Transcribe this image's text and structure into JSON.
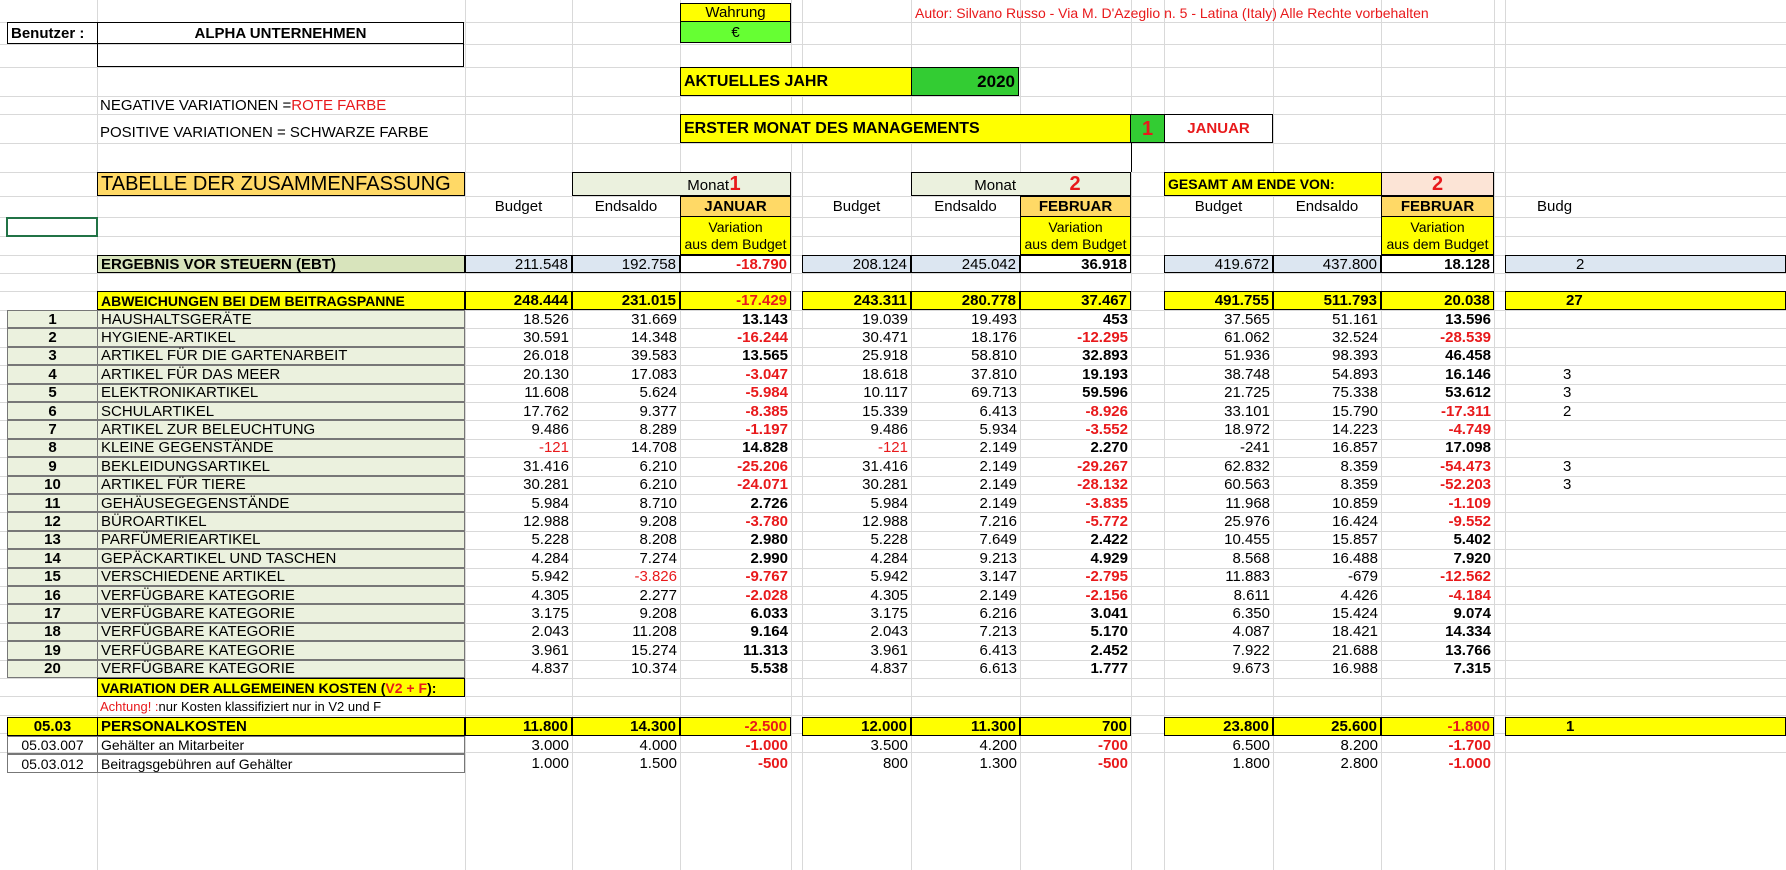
{
  "header": {
    "user_label": "Benutzer :",
    "company": "ALPHA UNTERNEHMEN",
    "currency_label": "Wahrung",
    "currency_value": "€",
    "author": "Autor: Silvano Russo - Via M. D'Azeglio n. 5 - Latina (Italy)   Alle Rechte vorbehalten",
    "current_year_label": "AKTUELLES JAHR",
    "current_year": "2020",
    "first_month_label": "ERSTER MONAT DES MANAGEMENTS",
    "first_month_num": "1",
    "first_month_name": "JANUAR",
    "neg_note_prefix": "NEGATIVE VARIATIONEN = ",
    "neg_note_color": "ROTE FARBE",
    "pos_note": "POSITIVE VARIATIONEN = SCHWARZE FARBE",
    "summary_title": "TABELLE DER ZUSAMMENFASSUNG"
  },
  "blocks": [
    {
      "top_label": "Monat",
      "top_num": "1",
      "month": "JANUAR"
    },
    {
      "top_label": "Monat",
      "top_num": "2",
      "month": "FEBRUAR"
    },
    {
      "top_label": "GESAMT AM ENDE VON:",
      "top_num": "2",
      "month": "FEBRUAR"
    }
  ],
  "col_headers": {
    "budget": "Budget",
    "endsaldo": "Endsaldo",
    "variation_1": "Variation",
    "variation_2": "aus dem Budget",
    "next_budget_partial": "Budg"
  },
  "ebt": {
    "label": "ERGEBNIS VOR STEUERN (EBT)",
    "values": [
      [
        "211.548",
        "192.758",
        "-18.790"
      ],
      [
        "208.124",
        "245.042",
        "36.918"
      ],
      [
        "419.672",
        "437.800",
        "18.128"
      ]
    ],
    "next_partial": "2"
  },
  "margin": {
    "label": "ABWEICHUNGEN BEI DEM BEITRAGSPANNE",
    "values": [
      [
        "248.444",
        "231.015",
        "-17.429"
      ],
      [
        "243.311",
        "280.778",
        "37.467"
      ],
      [
        "491.755",
        "511.793",
        "20.038"
      ]
    ],
    "next_partial": "27"
  },
  "rows": [
    {
      "num": "1",
      "label": "HAUSHALTSGERÄTE",
      "v": [
        [
          "18.526",
          "31.669",
          "13.143"
        ],
        [
          "19.039",
          "19.493",
          "453"
        ],
        [
          "37.565",
          "51.161",
          "13.596"
        ]
      ],
      "next": ""
    },
    {
      "num": "2",
      "label": "HYGIENE-ARTIKEL",
      "v": [
        [
          "30.591",
          "14.348",
          "-16.244"
        ],
        [
          "30.471",
          "18.176",
          "-12.295"
        ],
        [
          "61.062",
          "32.524",
          "-28.539"
        ]
      ],
      "next": ""
    },
    {
      "num": "3",
      "label": "ARTIKEL FÜR DIE GARTENARBEIT",
      "v": [
        [
          "26.018",
          "39.583",
          "13.565"
        ],
        [
          "25.918",
          "58.810",
          "32.893"
        ],
        [
          "51.936",
          "98.393",
          "46.458"
        ]
      ],
      "next": ""
    },
    {
      "num": "4",
      "label": "ARTIKEL FÜR DAS MEER",
      "v": [
        [
          "20.130",
          "17.083",
          "-3.047"
        ],
        [
          "18.618",
          "37.810",
          "19.193"
        ],
        [
          "38.748",
          "54.893",
          "16.146"
        ]
      ],
      "next": "3"
    },
    {
      "num": "5",
      "label": "ELEKTRONIKARTIKEL",
      "v": [
        [
          "11.608",
          "5.624",
          "-5.984"
        ],
        [
          "10.117",
          "69.713",
          "59.596"
        ],
        [
          "21.725",
          "75.338",
          "53.612"
        ]
      ],
      "next": "3"
    },
    {
      "num": "6",
      "label": "SCHULARTIKEL",
      "v": [
        [
          "17.762",
          "9.377",
          "-8.385"
        ],
        [
          "15.339",
          "6.413",
          "-8.926"
        ],
        [
          "33.101",
          "15.790",
          "-17.311"
        ]
      ],
      "next": "2"
    },
    {
      "num": "7",
      "label": "ARTIKEL ZUR BELEUCHTUNG",
      "v": [
        [
          "9.486",
          "8.289",
          "-1.197"
        ],
        [
          "9.486",
          "5.934",
          "-3.552"
        ],
        [
          "18.972",
          "14.223",
          "-4.749"
        ]
      ],
      "next": ""
    },
    {
      "num": "8",
      "label": "KLEINE GEGENSTÄNDE",
      "v": [
        [
          "-121",
          "14.708",
          "14.828"
        ],
        [
          "-121",
          "2.149",
          "2.270"
        ],
        [
          "-241",
          "16.857",
          "17.098"
        ]
      ],
      "next": ""
    },
    {
      "num": "9",
      "label": "BEKLEIDUNGSARTIKEL",
      "v": [
        [
          "31.416",
          "6.210",
          "-25.206"
        ],
        [
          "31.416",
          "2.149",
          "-29.267"
        ],
        [
          "62.832",
          "8.359",
          "-54.473"
        ]
      ],
      "next": "3"
    },
    {
      "num": "10",
      "label": "ARTIKEL FÜR TIERE",
      "v": [
        [
          "30.281",
          "6.210",
          "-24.071"
        ],
        [
          "30.281",
          "2.149",
          "-28.132"
        ],
        [
          "60.563",
          "8.359",
          "-52.203"
        ]
      ],
      "next": "3"
    },
    {
      "num": "11",
      "label": "GEHÄUSEGEGENSTÄNDE",
      "v": [
        [
          "5.984",
          "8.710",
          "2.726"
        ],
        [
          "5.984",
          "2.149",
          "-3.835"
        ],
        [
          "11.968",
          "10.859",
          "-1.109"
        ]
      ],
      "next": ""
    },
    {
      "num": "12",
      "label": "BÜROARTIKEL",
      "v": [
        [
          "12.988",
          "9.208",
          "-3.780"
        ],
        [
          "12.988",
          "7.216",
          "-5.772"
        ],
        [
          "25.976",
          "16.424",
          "-9.552"
        ]
      ],
      "next": ""
    },
    {
      "num": "13",
      "label": "PARFÜMERIEARTIKEL",
      "v": [
        [
          "5.228",
          "8.208",
          "2.980"
        ],
        [
          "5.228",
          "7.649",
          "2.422"
        ],
        [
          "10.455",
          "15.857",
          "5.402"
        ]
      ],
      "next": ""
    },
    {
      "num": "14",
      "label": "GEPÄCKARTIKEL UND TASCHEN",
      "v": [
        [
          "4.284",
          "7.274",
          "2.990"
        ],
        [
          "4.284",
          "9.213",
          "4.929"
        ],
        [
          "8.568",
          "16.488",
          "7.920"
        ]
      ],
      "next": ""
    },
    {
      "num": "15",
      "label": "VERSCHIEDENE ARTIKEL",
      "v": [
        [
          "5.942",
          "-3.826",
          "-9.767"
        ],
        [
          "5.942",
          "3.147",
          "-2.795"
        ],
        [
          "11.883",
          "-679",
          "-12.562"
        ]
      ],
      "next": ""
    },
    {
      "num": "16",
      "label": "VERFÜGBARE KATEGORIE",
      "v": [
        [
          "4.305",
          "2.277",
          "-2.028"
        ],
        [
          "4.305",
          "2.149",
          "-2.156"
        ],
        [
          "8.611",
          "4.426",
          "-4.184"
        ]
      ],
      "next": ""
    },
    {
      "num": "17",
      "label": "VERFÜGBARE KATEGORIE",
      "v": [
        [
          "3.175",
          "9.208",
          "6.033"
        ],
        [
          "3.175",
          "6.216",
          "3.041"
        ],
        [
          "6.350",
          "15.424",
          "9.074"
        ]
      ],
      "next": ""
    },
    {
      "num": "18",
      "label": "VERFÜGBARE KATEGORIE",
      "v": [
        [
          "2.043",
          "11.208",
          "9.164"
        ],
        [
          "2.043",
          "7.213",
          "5.170"
        ],
        [
          "4.087",
          "18.421",
          "14.334"
        ]
      ],
      "next": ""
    },
    {
      "num": "19",
      "label": "VERFÜGBARE KATEGORIE",
      "v": [
        [
          "3.961",
          "15.274",
          "11.313"
        ],
        [
          "3.961",
          "6.413",
          "2.452"
        ],
        [
          "7.922",
          "21.688",
          "13.766"
        ]
      ],
      "next": ""
    },
    {
      "num": "20",
      "label": "VERFÜGBARE KATEGORIE",
      "v": [
        [
          "4.837",
          "10.374",
          "5.538"
        ],
        [
          "4.837",
          "6.613",
          "1.777"
        ],
        [
          "9.673",
          "16.988",
          "7.315"
        ]
      ],
      "next": ""
    }
  ],
  "general_costs": {
    "label_prefix": "VARIATION DER ALLGEMEINEN KOSTEN (",
    "label_red": "V2 + F",
    "label_suffix": "):",
    "warn_red": "Achtung! :",
    "warn_rest": " nur Kosten klassifiziert nur in V2 und F"
  },
  "personnel": {
    "code": "05.03",
    "label": "PERSONALKOSTEN",
    "values": [
      [
        "11.800",
        "14.300",
        "-2.500"
      ],
      [
        "12.000",
        "11.300",
        "700"
      ],
      [
        "23.800",
        "25.600",
        "-1.800"
      ]
    ],
    "next_partial": "1"
  },
  "subrows": [
    {
      "code": "05.03.007",
      "label": "Gehälter an Mitarbeiter",
      "v": [
        [
          "3.000",
          "4.000",
          "-1.000"
        ],
        [
          "3.500",
          "4.200",
          "-700"
        ],
        [
          "6.500",
          "8.200",
          "-1.700"
        ]
      ]
    },
    {
      "code": "05.03.012",
      "label": "Beitragsgebühren auf Gehälter",
      "v": [
        [
          "1.000",
          "1.500",
          "-500"
        ],
        [
          "800",
          "1.300",
          "-500"
        ],
        [
          "1.800",
          "2.800",
          "-1.000"
        ]
      ]
    }
  ],
  "colors": {
    "yellow": "#ffff00",
    "green": "#33cc33",
    "light_green": "#d8e4bc",
    "label_green": "#ebf1de",
    "light_blue": "#dce6f1",
    "orange": "#ffd966",
    "peach": "#fce4d6",
    "month_header": "#ebf1de",
    "red": "#e8191b"
  }
}
